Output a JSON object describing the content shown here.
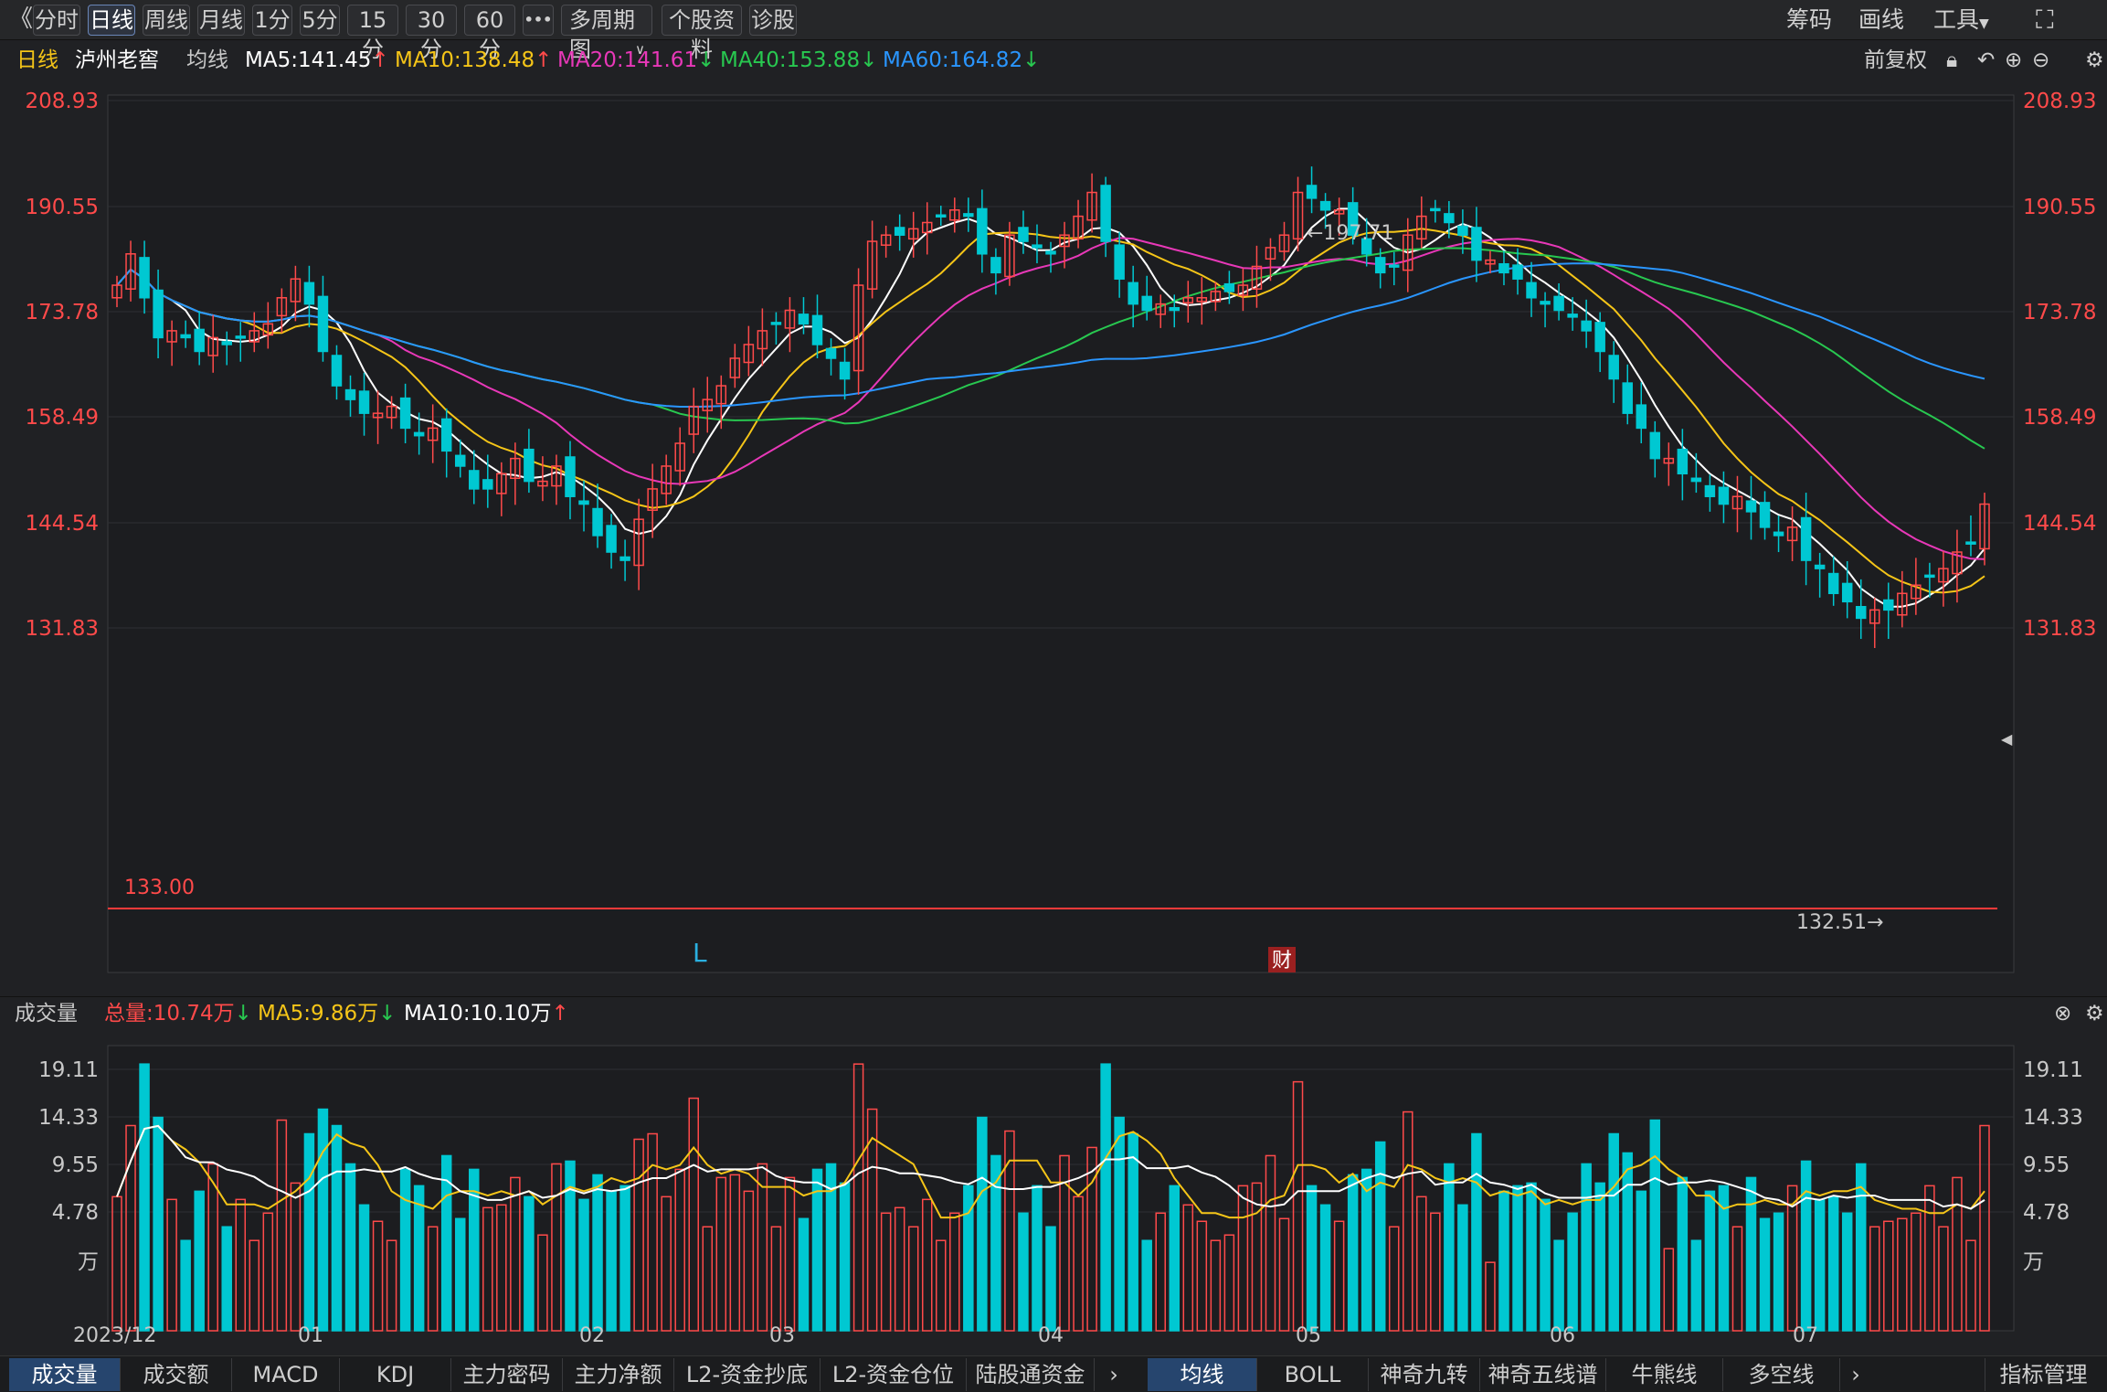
{
  "toolbar": {
    "back": "《",
    "periods": [
      "分时",
      "日线",
      "周线",
      "月线",
      "1分",
      "5分",
      "15分",
      "30分",
      "60分"
    ],
    "active": "日线",
    "more": "•••",
    "multi": "多周期图",
    "profile": "个股资料",
    "diagnose": "诊股",
    "right": [
      "筹码",
      "画线",
      "工具"
    ]
  },
  "info": {
    "period": "日线",
    "stock": "泸州老窖",
    "ma_label": "均线",
    "ma5": "MA5:141.45",
    "ma10": "MA10:138.48",
    "ma20": "MA20:141.61",
    "ma40": "MA40:153.88",
    "ma60": "MA60:164.82",
    "adjust": "前复权"
  },
  "colors": {
    "up": "#ff4a4a",
    "down": "#00c8d2",
    "ma5": "#ffffff",
    "ma10": "#f5c518",
    "ma20": "#e838b8",
    "ma40": "#28c850",
    "ma60": "#2a96ff"
  },
  "main": {
    "price_axis": [
      "208.93",
      "190.55",
      "173.78",
      "158.49",
      "144.54",
      "131.83"
    ],
    "support_label": "133.00",
    "high_label": "←197.71",
    "low_label": "132.51→",
    "marker_L": "L",
    "marker_cai": "财"
  },
  "volume": {
    "title": "成交量",
    "total": "总量:10.74万",
    "ma5": "MA5:9.86万",
    "ma10": "MA10:10.10万",
    "axis": [
      "19.11",
      "14.33",
      "9.55",
      "4.78",
      "万"
    ]
  },
  "dates": [
    "2023/12",
    "01",
    "02",
    "03",
    "04",
    "05",
    "06",
    "07"
  ],
  "bottom": {
    "left_tabs": [
      "成交量",
      "成交额",
      "MACD",
      "KDJ",
      "主力密码",
      "主力净额",
      "L2-资金抄底",
      "L2-资金仓位",
      "陆股通资金"
    ],
    "right_tabs": [
      "均线",
      "BOLL",
      "神奇九转",
      "神奇五线谱",
      "牛熊线",
      "多空线"
    ],
    "manage": "指标管理"
  },
  "chart_data": {
    "type": "candlestick",
    "title": "泸州老窖 日线",
    "ylim": [
      131.83,
      208.93
    ],
    "support_line": 133.0,
    "high_point": 197.71,
    "low_point": 132.51,
    "months": [
      "2023/12",
      "01",
      "02",
      "03",
      "04",
      "05",
      "06",
      "07"
    ],
    "closes": [
      178,
      183,
      176,
      170,
      171,
      170,
      168,
      170,
      169,
      170,
      171,
      172,
      176,
      179,
      175,
      168,
      163,
      161,
      159,
      159,
      160,
      157,
      156,
      157,
      154,
      152,
      149,
      149,
      151,
      153,
      150,
      150,
      152,
      148,
      147,
      143,
      141,
      140,
      145,
      149,
      152,
      155,
      160,
      161,
      163,
      167,
      169,
      171,
      172,
      174,
      172,
      169,
      167,
      164,
      178,
      185,
      186,
      186,
      187,
      188,
      189,
      190,
      189,
      183,
      180,
      186,
      185,
      184,
      183,
      186,
      189,
      193,
      185,
      179,
      175,
      174,
      175,
      174,
      176,
      176,
      177,
      177,
      178,
      181,
      184,
      186,
      193,
      192,
      190,
      190,
      186,
      183,
      180,
      181,
      186,
      189,
      190,
      188,
      186,
      182,
      182,
      180,
      179,
      176,
      175,
      174,
      173,
      171,
      168,
      164,
      159,
      157,
      153,
      153,
      151,
      150,
      148,
      147,
      148,
      146,
      144,
      143,
      144,
      140,
      139,
      136,
      135,
      133,
      134,
      134,
      136,
      137,
      138,
      139,
      141,
      142,
      147
    ]
  }
}
